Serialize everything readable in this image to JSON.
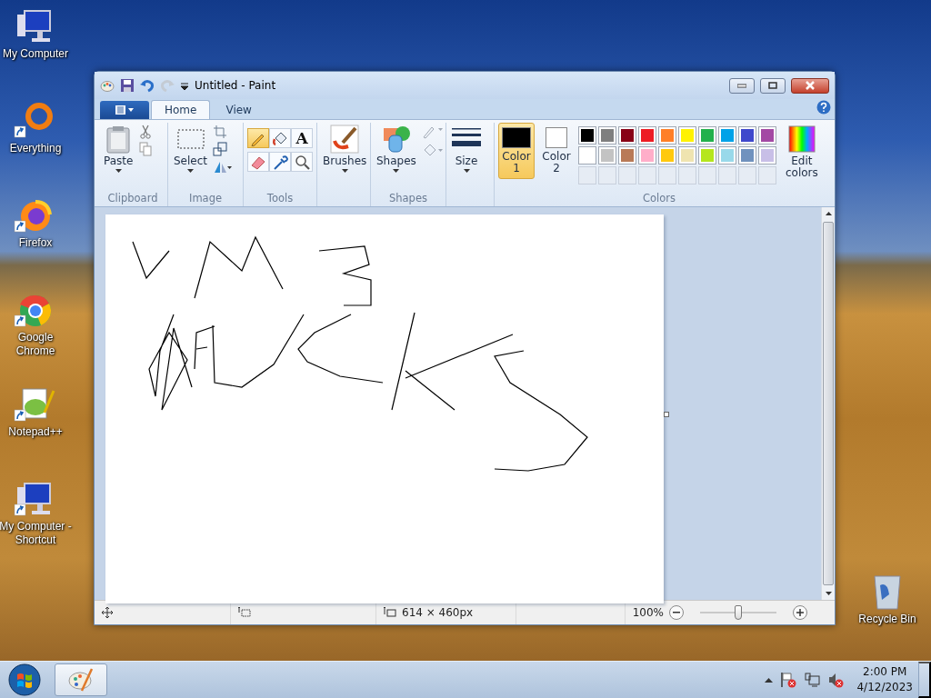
{
  "desktop": {
    "icons": [
      {
        "label": "My Computer",
        "kind": "computer",
        "shortcut": false
      },
      {
        "label": "Everything",
        "kind": "everything",
        "shortcut": true
      },
      {
        "label": "Firefox",
        "kind": "firefox",
        "shortcut": true
      },
      {
        "label": "Google Chrome",
        "kind": "chrome",
        "shortcut": true
      },
      {
        "label": "Notepad++",
        "kind": "notepad",
        "shortcut": true
      },
      {
        "label": "My Computer - Shortcut",
        "kind": "computer",
        "shortcut": true
      }
    ],
    "recycle_bin": {
      "label": "Recycle Bin"
    }
  },
  "window": {
    "title": "Untitled - Paint",
    "tabs": [
      {
        "label": "Home",
        "selected": true
      },
      {
        "label": "View",
        "selected": false
      }
    ],
    "clipboard": {
      "paste": "Paste",
      "group": "Clipboard"
    },
    "image": {
      "select": "Select",
      "group": "Image"
    },
    "tools": {
      "group": "Tools",
      "items": [
        {
          "kind": "pencil",
          "selected": true
        },
        {
          "kind": "fill",
          "selected": false
        },
        {
          "kind": "text",
          "glyph": "A",
          "selected": false
        },
        {
          "kind": "eraser",
          "selected": false
        },
        {
          "kind": "picker",
          "selected": false
        },
        {
          "kind": "magnifier",
          "selected": false
        }
      ]
    },
    "brushes": {
      "label": "Brushes"
    },
    "shapes": {
      "label": "Shapes",
      "group": "Shapes"
    },
    "size": {
      "label": "Size"
    },
    "colors": {
      "group": "Colors",
      "slots": [
        {
          "label": "Color\n1",
          "color": "#000000",
          "selected": true
        },
        {
          "label": "Color\n2",
          "color": "#ffffff",
          "selected": false
        }
      ],
      "palette": [
        {
          "color": "#000000"
        },
        {
          "color": "#7f7f7f"
        },
        {
          "color": "#880015"
        },
        {
          "color": "#ed1c24"
        },
        {
          "color": "#ff7f27"
        },
        {
          "color": "#fff200"
        },
        {
          "color": "#22b14c"
        },
        {
          "color": "#00a2e8"
        },
        {
          "color": "#3f48cc"
        },
        {
          "color": "#a349a4"
        },
        {
          "color": "#ffffff"
        },
        {
          "color": "#c3c3c3"
        },
        {
          "color": "#b97a57"
        },
        {
          "color": "#ffaec9"
        },
        {
          "color": "#ffc90e"
        },
        {
          "color": "#efe4b0"
        },
        {
          "color": "#b5e61d"
        },
        {
          "color": "#99d9ea"
        },
        {
          "color": "#7092be"
        },
        {
          "color": "#c8bfe7"
        }
      ],
      "edit": "Edit\ncolors"
    },
    "status_bar": {
      "dimensions": "614 × 460px",
      "zoom": "100%",
      "zoom_level": {
        "level": 0.5
      }
    }
  },
  "taskbar": {
    "time": "2:00 PM",
    "date": "4/12/2023"
  }
}
